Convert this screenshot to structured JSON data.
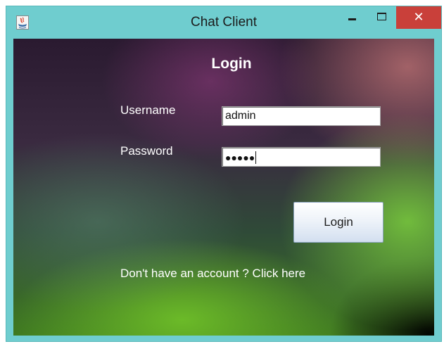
{
  "window": {
    "title": "Chat Client",
    "close_glyph": "✕"
  },
  "form": {
    "heading": "Login",
    "username_label": "Username",
    "username_value": "admin",
    "password_label": "Password",
    "password_masked": "●●●●●",
    "login_button": "Login",
    "signup_text": "Don't have an account ? Click here"
  },
  "icons": {
    "app": "java-app-icon",
    "minimize": "minimize-icon",
    "maximize": "maximize-icon",
    "close": "close-icon"
  },
  "colors": {
    "titlebar": "#6fcdcf",
    "close_button": "#c9403a",
    "text_on_background": "#ffffff"
  }
}
